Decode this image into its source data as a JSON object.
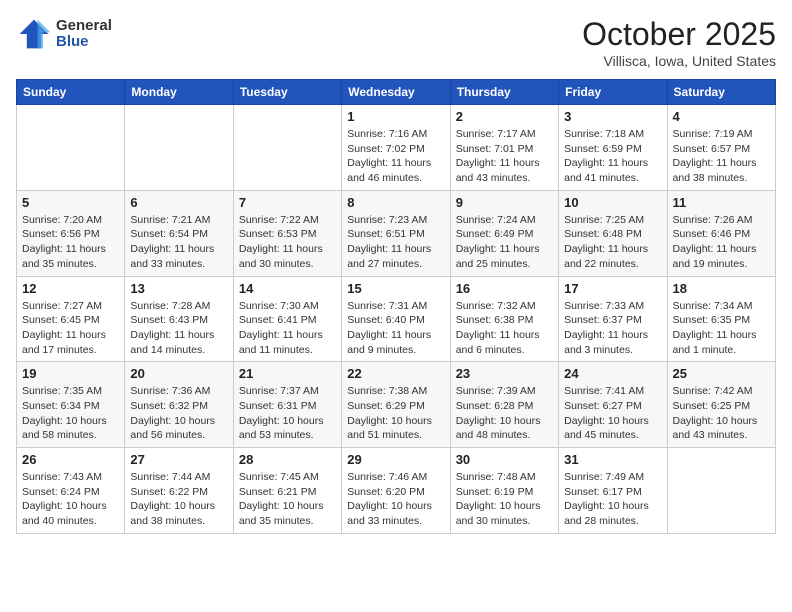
{
  "header": {
    "logo_general": "General",
    "logo_blue": "Blue",
    "title": "October 2025",
    "location": "Villisca, Iowa, United States"
  },
  "days_of_week": [
    "Sunday",
    "Monday",
    "Tuesday",
    "Wednesday",
    "Thursday",
    "Friday",
    "Saturday"
  ],
  "weeks": [
    [
      {
        "day": "",
        "info": ""
      },
      {
        "day": "",
        "info": ""
      },
      {
        "day": "",
        "info": ""
      },
      {
        "day": "1",
        "info": "Sunrise: 7:16 AM\nSunset: 7:02 PM\nDaylight: 11 hours and 46 minutes."
      },
      {
        "day": "2",
        "info": "Sunrise: 7:17 AM\nSunset: 7:01 PM\nDaylight: 11 hours and 43 minutes."
      },
      {
        "day": "3",
        "info": "Sunrise: 7:18 AM\nSunset: 6:59 PM\nDaylight: 11 hours and 41 minutes."
      },
      {
        "day": "4",
        "info": "Sunrise: 7:19 AM\nSunset: 6:57 PM\nDaylight: 11 hours and 38 minutes."
      }
    ],
    [
      {
        "day": "5",
        "info": "Sunrise: 7:20 AM\nSunset: 6:56 PM\nDaylight: 11 hours and 35 minutes."
      },
      {
        "day": "6",
        "info": "Sunrise: 7:21 AM\nSunset: 6:54 PM\nDaylight: 11 hours and 33 minutes."
      },
      {
        "day": "7",
        "info": "Sunrise: 7:22 AM\nSunset: 6:53 PM\nDaylight: 11 hours and 30 minutes."
      },
      {
        "day": "8",
        "info": "Sunrise: 7:23 AM\nSunset: 6:51 PM\nDaylight: 11 hours and 27 minutes."
      },
      {
        "day": "9",
        "info": "Sunrise: 7:24 AM\nSunset: 6:49 PM\nDaylight: 11 hours and 25 minutes."
      },
      {
        "day": "10",
        "info": "Sunrise: 7:25 AM\nSunset: 6:48 PM\nDaylight: 11 hours and 22 minutes."
      },
      {
        "day": "11",
        "info": "Sunrise: 7:26 AM\nSunset: 6:46 PM\nDaylight: 11 hours and 19 minutes."
      }
    ],
    [
      {
        "day": "12",
        "info": "Sunrise: 7:27 AM\nSunset: 6:45 PM\nDaylight: 11 hours and 17 minutes."
      },
      {
        "day": "13",
        "info": "Sunrise: 7:28 AM\nSunset: 6:43 PM\nDaylight: 11 hours and 14 minutes."
      },
      {
        "day": "14",
        "info": "Sunrise: 7:30 AM\nSunset: 6:41 PM\nDaylight: 11 hours and 11 minutes."
      },
      {
        "day": "15",
        "info": "Sunrise: 7:31 AM\nSunset: 6:40 PM\nDaylight: 11 hours and 9 minutes."
      },
      {
        "day": "16",
        "info": "Sunrise: 7:32 AM\nSunset: 6:38 PM\nDaylight: 11 hours and 6 minutes."
      },
      {
        "day": "17",
        "info": "Sunrise: 7:33 AM\nSunset: 6:37 PM\nDaylight: 11 hours and 3 minutes."
      },
      {
        "day": "18",
        "info": "Sunrise: 7:34 AM\nSunset: 6:35 PM\nDaylight: 11 hours and 1 minute."
      }
    ],
    [
      {
        "day": "19",
        "info": "Sunrise: 7:35 AM\nSunset: 6:34 PM\nDaylight: 10 hours and 58 minutes."
      },
      {
        "day": "20",
        "info": "Sunrise: 7:36 AM\nSunset: 6:32 PM\nDaylight: 10 hours and 56 minutes."
      },
      {
        "day": "21",
        "info": "Sunrise: 7:37 AM\nSunset: 6:31 PM\nDaylight: 10 hours and 53 minutes."
      },
      {
        "day": "22",
        "info": "Sunrise: 7:38 AM\nSunset: 6:29 PM\nDaylight: 10 hours and 51 minutes."
      },
      {
        "day": "23",
        "info": "Sunrise: 7:39 AM\nSunset: 6:28 PM\nDaylight: 10 hours and 48 minutes."
      },
      {
        "day": "24",
        "info": "Sunrise: 7:41 AM\nSunset: 6:27 PM\nDaylight: 10 hours and 45 minutes."
      },
      {
        "day": "25",
        "info": "Sunrise: 7:42 AM\nSunset: 6:25 PM\nDaylight: 10 hours and 43 minutes."
      }
    ],
    [
      {
        "day": "26",
        "info": "Sunrise: 7:43 AM\nSunset: 6:24 PM\nDaylight: 10 hours and 40 minutes."
      },
      {
        "day": "27",
        "info": "Sunrise: 7:44 AM\nSunset: 6:22 PM\nDaylight: 10 hours and 38 minutes."
      },
      {
        "day": "28",
        "info": "Sunrise: 7:45 AM\nSunset: 6:21 PM\nDaylight: 10 hours and 35 minutes."
      },
      {
        "day": "29",
        "info": "Sunrise: 7:46 AM\nSunset: 6:20 PM\nDaylight: 10 hours and 33 minutes."
      },
      {
        "day": "30",
        "info": "Sunrise: 7:48 AM\nSunset: 6:19 PM\nDaylight: 10 hours and 30 minutes."
      },
      {
        "day": "31",
        "info": "Sunrise: 7:49 AM\nSunset: 6:17 PM\nDaylight: 10 hours and 28 minutes."
      },
      {
        "day": "",
        "info": ""
      }
    ]
  ]
}
